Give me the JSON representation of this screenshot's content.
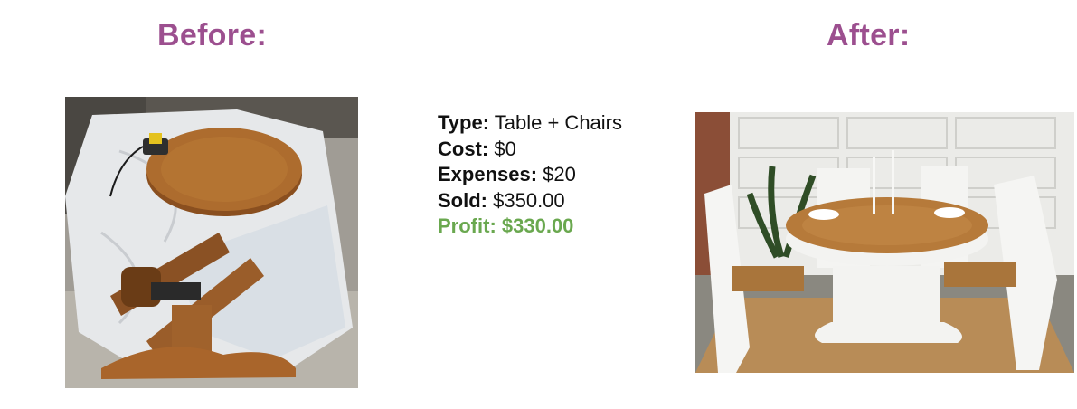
{
  "before": {
    "heading": "Before:"
  },
  "after": {
    "heading": "After:"
  },
  "details": {
    "type": {
      "label": "Type:",
      "value": "Table + Chairs"
    },
    "cost": {
      "label": "Cost:",
      "value": "$0"
    },
    "expenses": {
      "label": "Expenses:",
      "value": "$20"
    },
    "sold": {
      "label": "Sold:",
      "value": "$350.00"
    },
    "profit": {
      "label": "Profit:",
      "value": "$330.00"
    }
  },
  "colors": {
    "heading": "#9c4f8f",
    "profit": "#6aa84f",
    "text": "#111111"
  }
}
